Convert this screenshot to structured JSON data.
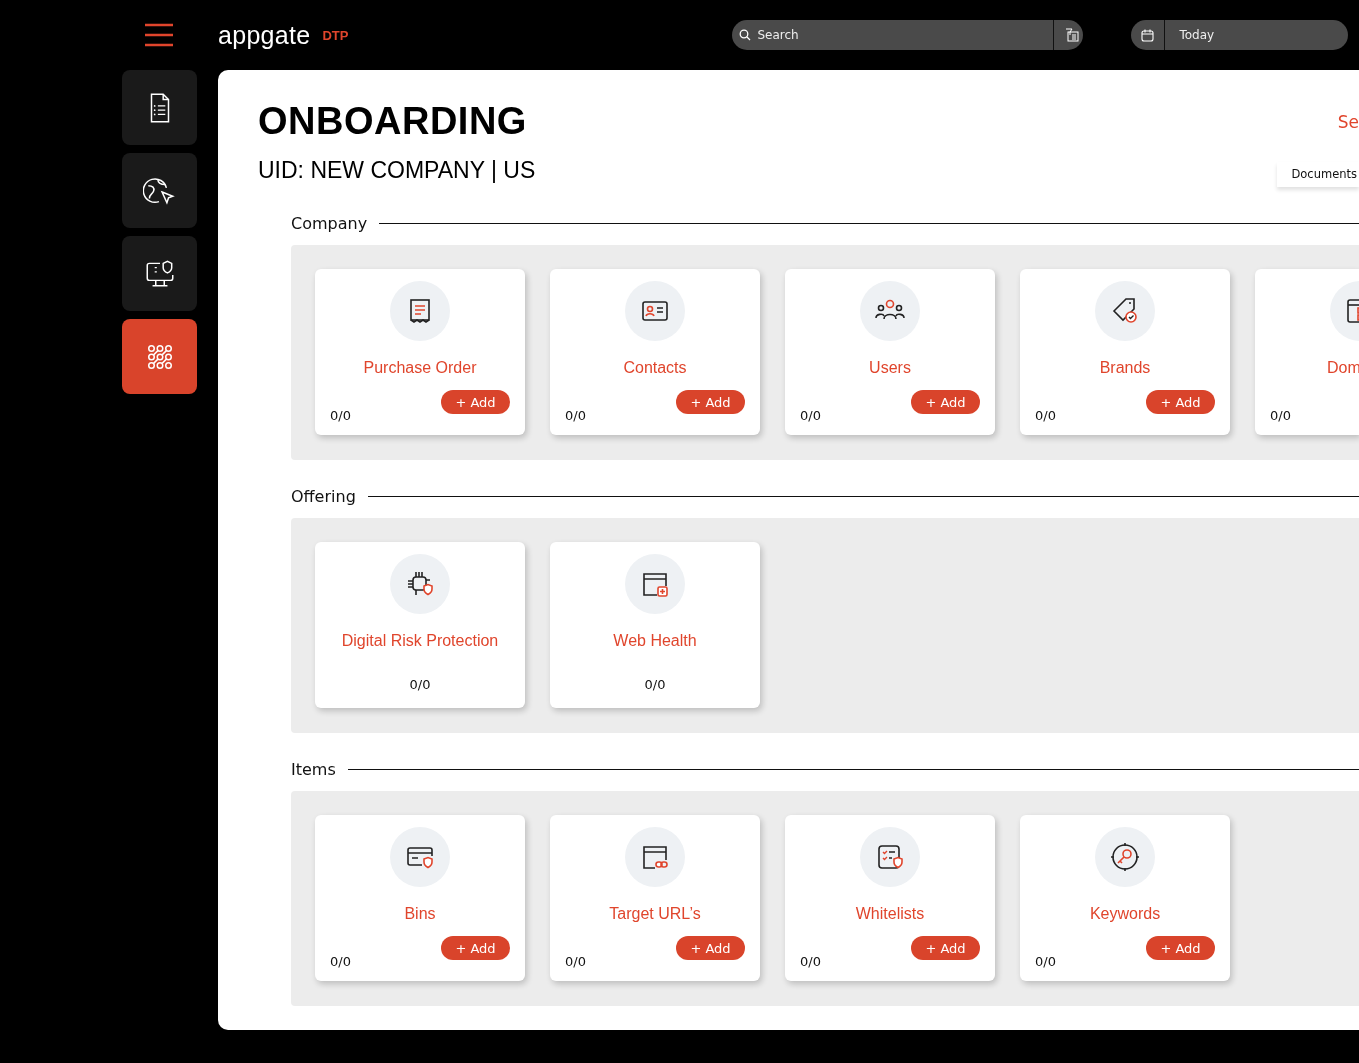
{
  "header": {
    "logo": "appgate",
    "logo_suffix": "DTP",
    "search": {
      "placeholder": "Search"
    },
    "date": {
      "value": "Today"
    }
  },
  "sidebar": {
    "items": [
      {
        "selected": false
      },
      {
        "selected": false
      },
      {
        "selected": false
      },
      {
        "selected": true
      }
    ]
  },
  "page": {
    "title": "ONBOARDING",
    "subtitle": "UID: NEW COMPANY | US",
    "link": "Se",
    "tab": "Documents"
  },
  "sections": [
    {
      "label": "Company",
      "cards": [
        {
          "kind": "action",
          "title": "Purchase Order",
          "count": "0/0",
          "add": "+ Add"
        },
        {
          "kind": "action",
          "title": "Contacts",
          "count": "0/0",
          "add": "+ Add"
        },
        {
          "kind": "action",
          "title": "Users",
          "count": "0/0",
          "add": "+ Add"
        },
        {
          "kind": "action",
          "title": "Brands",
          "count": "0/0",
          "add": "+ Add"
        },
        {
          "kind": "cut",
          "title": "Dom",
          "count": "0/0"
        }
      ]
    },
    {
      "label": "Offering",
      "cards": [
        {
          "kind": "plain",
          "title": "Digital Risk Protection",
          "count": "0/0"
        },
        {
          "kind": "plain",
          "title": "Web Health",
          "count": "0/0"
        }
      ]
    },
    {
      "label": "Items",
      "cards": [
        {
          "kind": "action",
          "title": "Bins",
          "count": "0/0",
          "add": "+ Add"
        },
        {
          "kind": "action",
          "title": "Target URL’s",
          "count": "0/0",
          "add": "+ Add"
        },
        {
          "kind": "action",
          "title": "Whitelists",
          "count": "0/0",
          "add": "+ Add"
        },
        {
          "kind": "action",
          "title": "Keywords",
          "count": "0/0",
          "add": "+ Add"
        }
      ]
    }
  ]
}
